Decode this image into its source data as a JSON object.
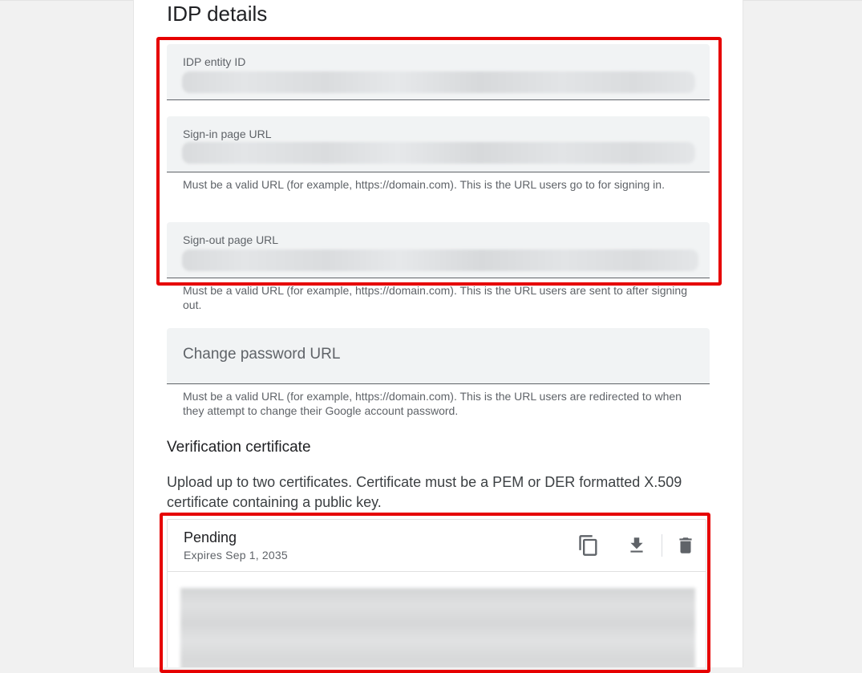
{
  "page": {
    "title": "IDP details"
  },
  "fields": {
    "entity_id": {
      "label": "IDP entity ID",
      "value": ""
    },
    "signin_url": {
      "label": "Sign-in page URL",
      "value": "",
      "hint": "Must be a valid URL (for example, https://domain.com). This is the URL users go to for signing in."
    },
    "signout_url": {
      "label": "Sign-out page URL",
      "value": "",
      "hint": "Must be a valid URL (for example, https://domain.com). This is the URL users are sent to after signing out."
    },
    "change_password_url": {
      "placeholder": "Change password URL",
      "hint": "Must be a valid URL (for example, https://domain.com). This is the URL users are redirected to when they attempt to change their Google account password."
    }
  },
  "certificate_section": {
    "heading": "Verification certificate",
    "description": "Upload up to two certificates. Certificate must be a PEM or DER formatted X.509 certificate containing a public key.",
    "card": {
      "status": "Pending",
      "expiry": "Expires Sep 1, 2035",
      "actions": [
        {
          "name": "copy-icon"
        },
        {
          "name": "download-icon"
        },
        {
          "name": "delete-icon"
        }
      ]
    }
  },
  "colors": {
    "highlight": "#e60000",
    "field_bg": "#f1f3f4",
    "hint_text": "#5f6368"
  }
}
